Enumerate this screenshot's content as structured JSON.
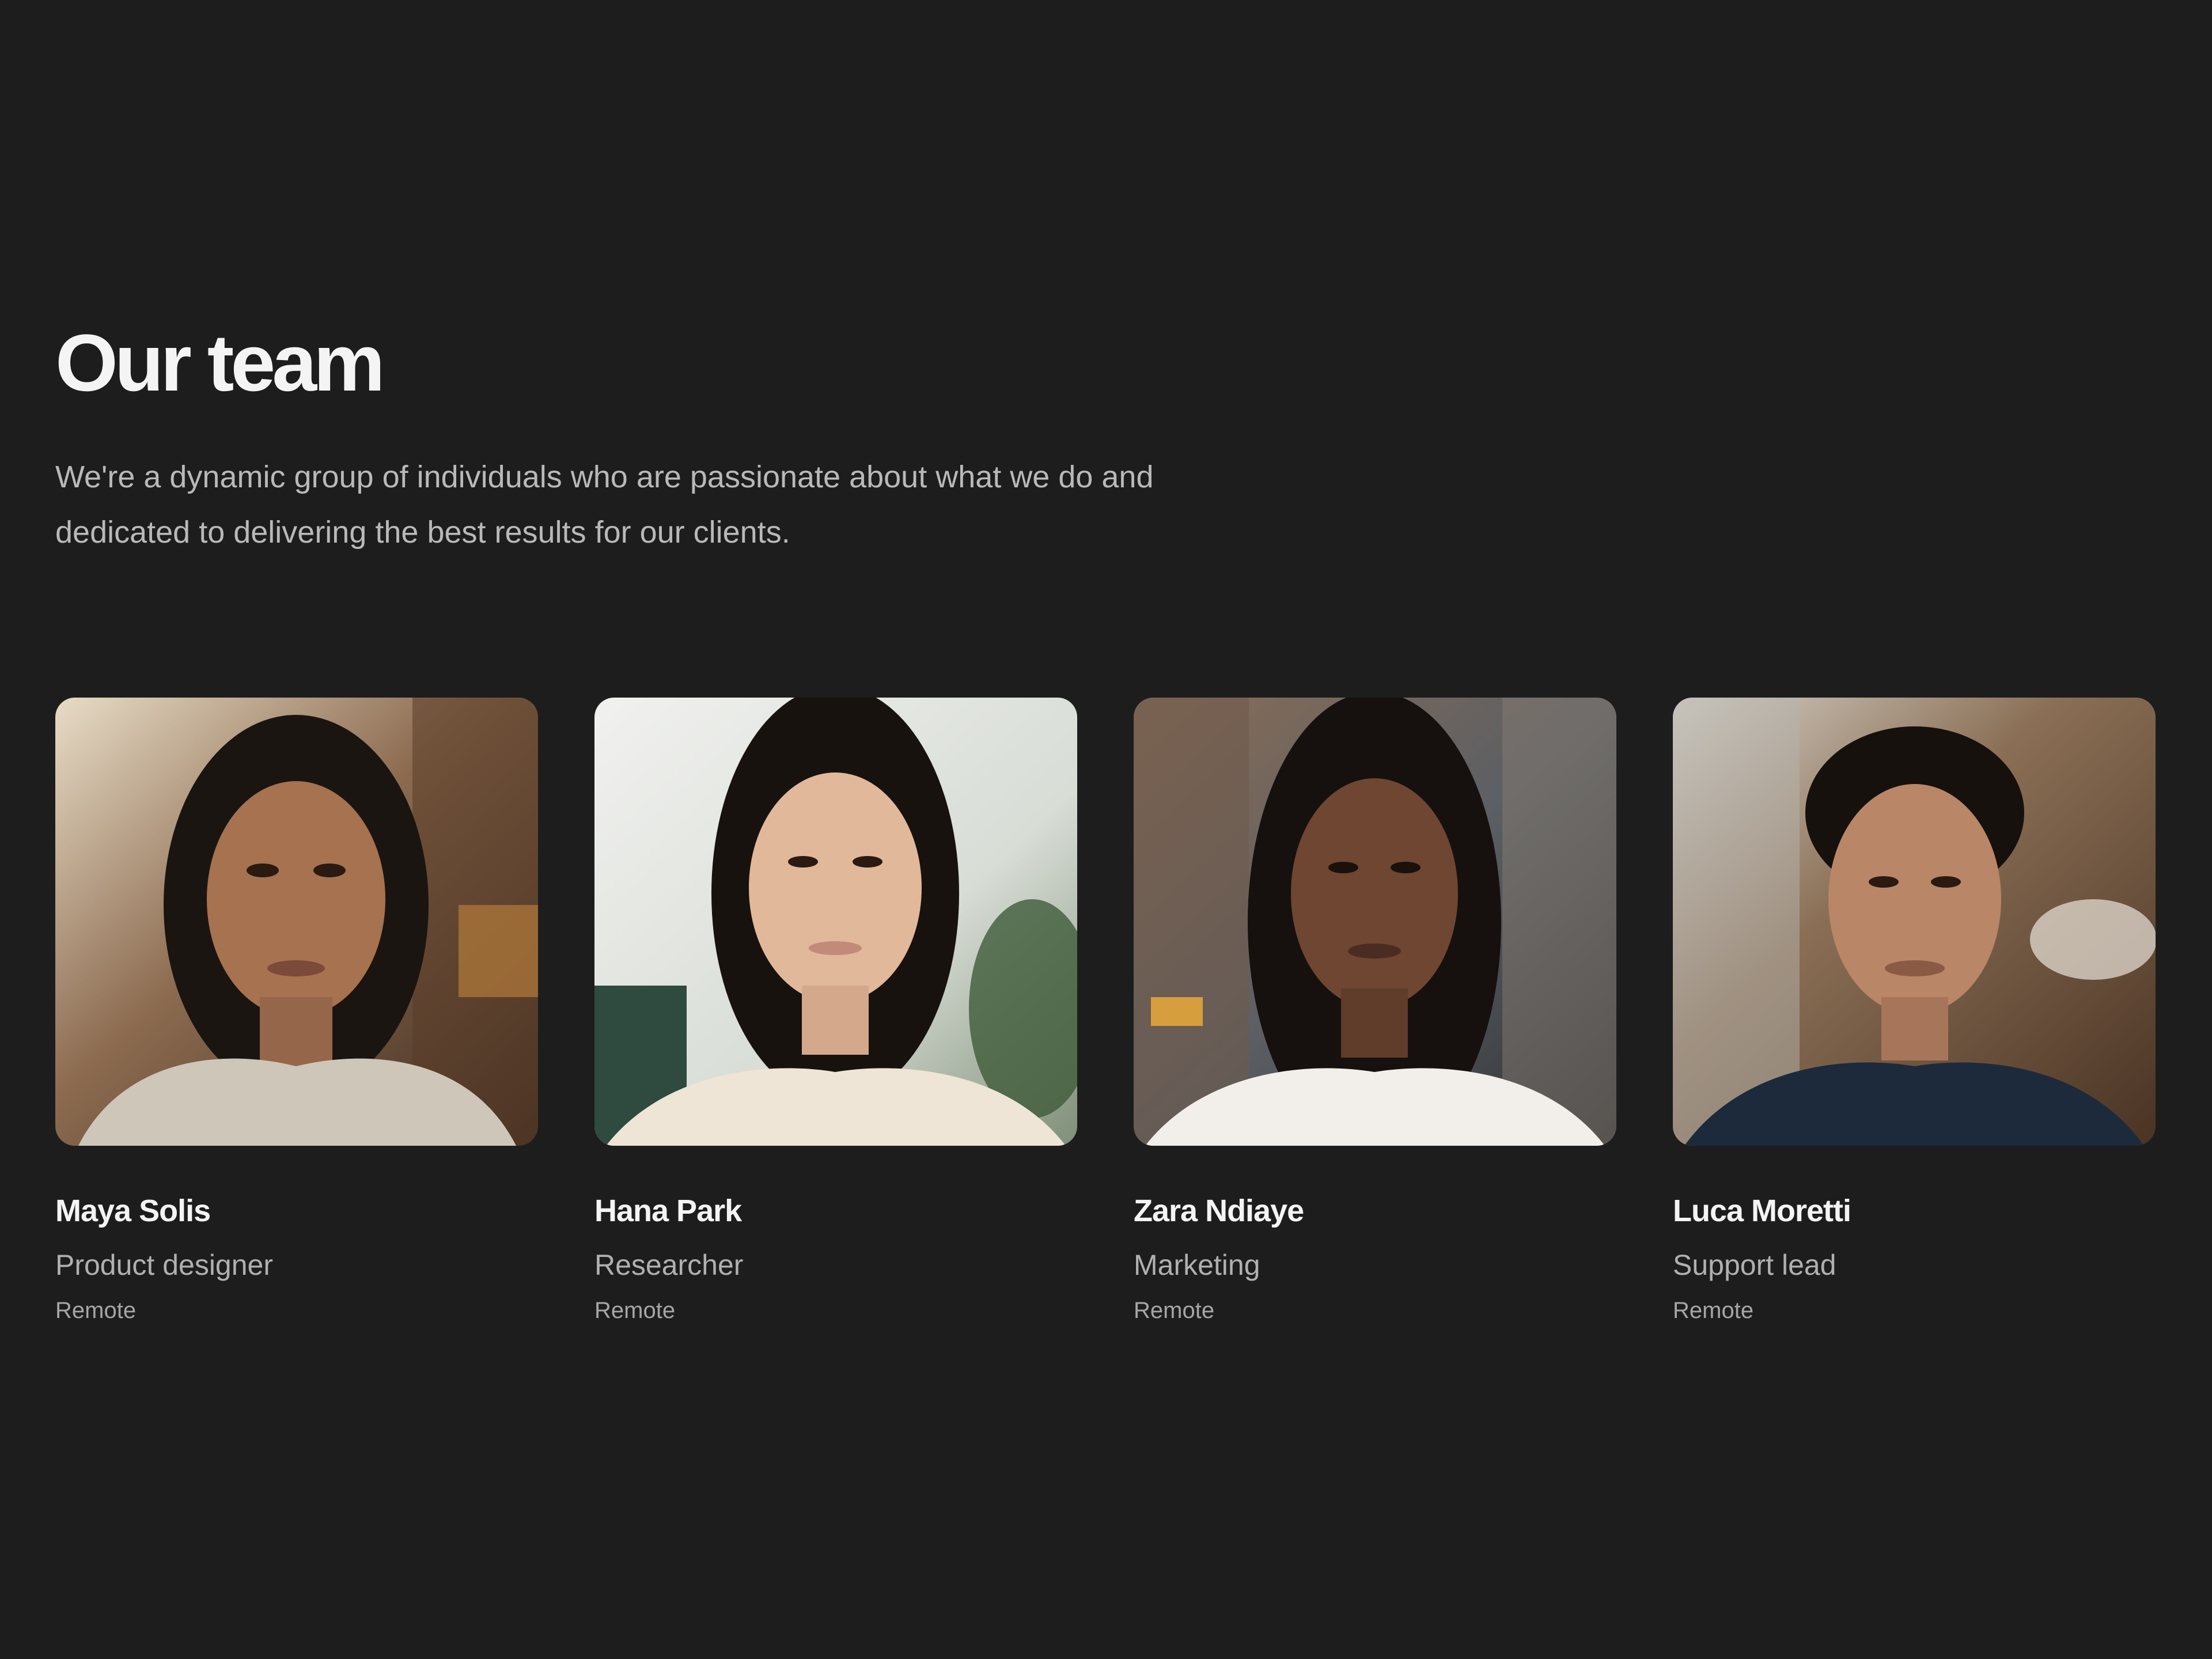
{
  "page": {
    "title": "Our team",
    "intro": "We're a dynamic group of individuals who are passionate about what we do and dedicated to delivering the best results for our clients.",
    "background_color": "#1d1d1d"
  },
  "members": [
    {
      "name": "Maya Solis",
      "role": "Product designer",
      "location": "Remote",
      "photo_alt": "portrait-photo"
    },
    {
      "name": "Hana Park",
      "role": "Researcher",
      "location": "Remote",
      "photo_alt": "portrait-photo"
    },
    {
      "name": "Zara Ndiaye",
      "role": "Marketing",
      "location": "Remote",
      "photo_alt": "portrait-photo"
    },
    {
      "name": "Luca Moretti",
      "role": "Support lead",
      "location": "Remote",
      "photo_alt": "portrait-photo"
    }
  ]
}
